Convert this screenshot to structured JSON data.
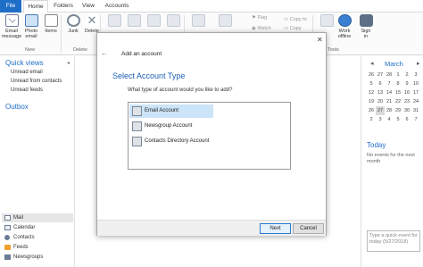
{
  "tabs": [
    "File",
    "Home",
    "Folders",
    "View",
    "Accounts"
  ],
  "ribbon": {
    "email_message": "Email\nmessage",
    "email_label_1": "Email",
    "email_label_2": "message",
    "photo_label_1": "Photo",
    "photo_label_2": "email",
    "items_label": "Items",
    "junk_label": "Junk",
    "delete_label": "Delete",
    "new_group": "New",
    "delete_group": "Delete",
    "flag_label": "Flag",
    "watch_label": "Watch",
    "copy_to_label": "Copy to",
    "copy_label": "Copy",
    "work_offline_1": "Work",
    "work_offline_2": "offline",
    "sign_in_1": "Sign",
    "sign_in_2": "in",
    "tools_group": "Tools"
  },
  "nav": {
    "quick_views": "Quick views",
    "items": [
      "Unread email",
      "Unread from contacts",
      "Unread feeds"
    ],
    "outbox": "Outbox",
    "modules": [
      "Mail",
      "Calendar",
      "Contacts",
      "Feeds",
      "Newsgroups"
    ]
  },
  "calendar": {
    "month": "March",
    "weeks": [
      [
        "26",
        "27",
        "28",
        "1",
        "2",
        "3"
      ],
      [
        "5",
        "6",
        "7",
        "8",
        "9",
        "10"
      ],
      [
        "12",
        "13",
        "14",
        "15",
        "16",
        "17"
      ],
      [
        "19",
        "20",
        "21",
        "22",
        "23",
        "24"
      ],
      [
        "26",
        "27",
        "28",
        "29",
        "30",
        "31"
      ],
      [
        "2",
        "3",
        "4",
        "5",
        "6",
        "7"
      ]
    ],
    "today_cell": "27",
    "today_label": "Today",
    "no_events": "No events for the next month",
    "quick_event": "Type a quick event for today (5/27/2018)"
  },
  "dialog": {
    "title": "Add an account",
    "heading": "Select Account Type",
    "question": "What type of account would you like to add?",
    "options": [
      "Email Account",
      "Newsgroup Account",
      "Contacts Directory Account"
    ],
    "selected_index": 0,
    "next_label": "Next",
    "cancel_label": "Cancel"
  }
}
